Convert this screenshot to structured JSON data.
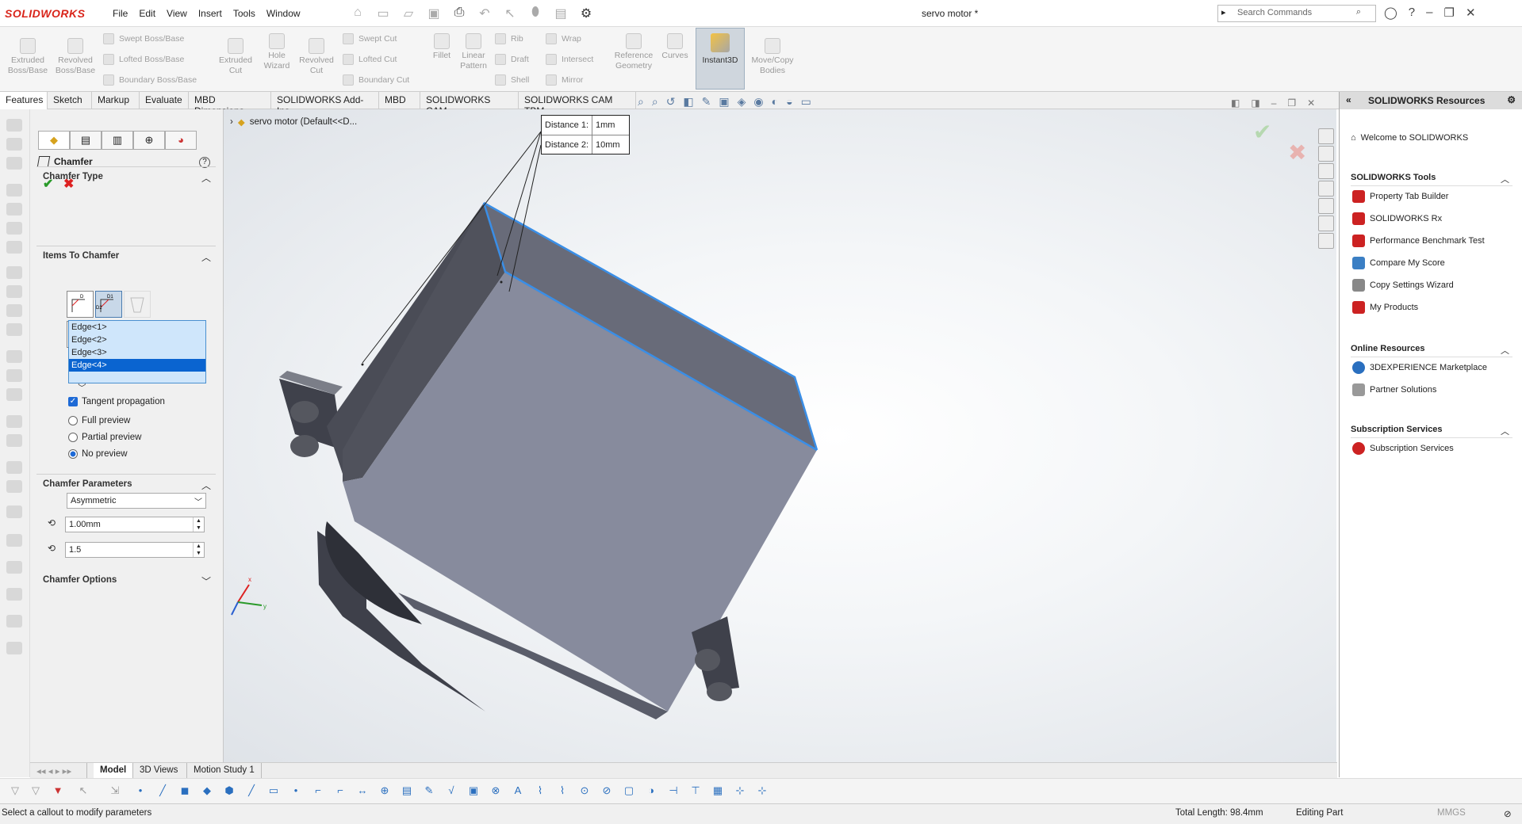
{
  "app": {
    "logo": "SOLIDWORKS",
    "doc_title": "servo motor *"
  },
  "menu": [
    "File",
    "Edit",
    "View",
    "Insert",
    "Tools",
    "Window"
  ],
  "search": {
    "placeholder": "Search Commands"
  },
  "ribbon": {
    "large": [
      {
        "label": "Extruded\nBoss/Base"
      },
      {
        "label": "Revolved\nBoss/Base"
      },
      {
        "label": "Extruded\nCut"
      },
      {
        "label": "Hole\nWizard"
      },
      {
        "label": "Revolved\nCut"
      },
      {
        "label": "Fillet"
      },
      {
        "label": "Linear\nPattern"
      },
      {
        "label": "Reference\nGeometry"
      },
      {
        "label": "Curves"
      },
      {
        "label": "Move/Copy\nBodies"
      }
    ],
    "small": [
      "Swept Boss/Base",
      "Lofted Boss/Base",
      "Boundary Boss/Base",
      "Swept Cut",
      "Lofted Cut",
      "Boundary Cut",
      "Rib",
      "Draft",
      "Shell",
      "Wrap",
      "Intersect",
      "Mirror"
    ],
    "instant3d": "Instant3D"
  },
  "tabs": [
    "Features",
    "Sketch",
    "Markup",
    "Evaluate",
    "MBD Dimensions",
    "SOLIDWORKS Add-Ins",
    "MBD",
    "SOLIDWORKS CAM",
    "SOLIDWORKS CAM TBM"
  ],
  "pm": {
    "title": "Chamfer",
    "sections": {
      "type": "Chamfer Type",
      "items": "Items To Chamfer",
      "params": "Chamfer Parameters",
      "options": "Chamfer Options"
    },
    "edges": [
      "Edge<1>",
      "Edge<2>",
      "Edge<3>",
      "Edge<4>"
    ],
    "tangent": "Tangent propagation",
    "previews": [
      "Full preview",
      "Partial preview",
      "No preview"
    ],
    "mode": "Asymmetric",
    "d1": "1.00mm",
    "d2": "1.5"
  },
  "tree": {
    "label": "servo motor  (Default<<D..."
  },
  "callout": {
    "d1_label": "Distance 1:",
    "d1_val": "1mm",
    "d2_label": "Distance 2:",
    "d2_val": "10mm"
  },
  "taskpane": {
    "title": "SOLIDWORKS Resources",
    "welcome": "Welcome to SOLIDWORKS",
    "tools_head": "SOLIDWORKS Tools",
    "tools": [
      "Property Tab Builder",
      "SOLIDWORKS Rx",
      "Performance Benchmark Test",
      "Compare My Score",
      "Copy Settings Wizard",
      "My Products"
    ],
    "online_head": "Online Resources",
    "online": [
      "3DEXPERIENCE Marketplace",
      "Partner Solutions"
    ],
    "sub_head": "Subscription Services",
    "sub": [
      "Subscription Services"
    ]
  },
  "bottom_tabs": [
    "Model",
    "3D Views",
    "Motion Study 1"
  ],
  "status": {
    "hint": "Select a callout to modify parameters",
    "length": "Total Length: 98.4mm",
    "mode": "Editing Part",
    "units": "MMGS"
  },
  "colors": {
    "accent": "#1e6ad6",
    "selected_edge": "#3a8ee6",
    "part": "#6b6e7c"
  }
}
